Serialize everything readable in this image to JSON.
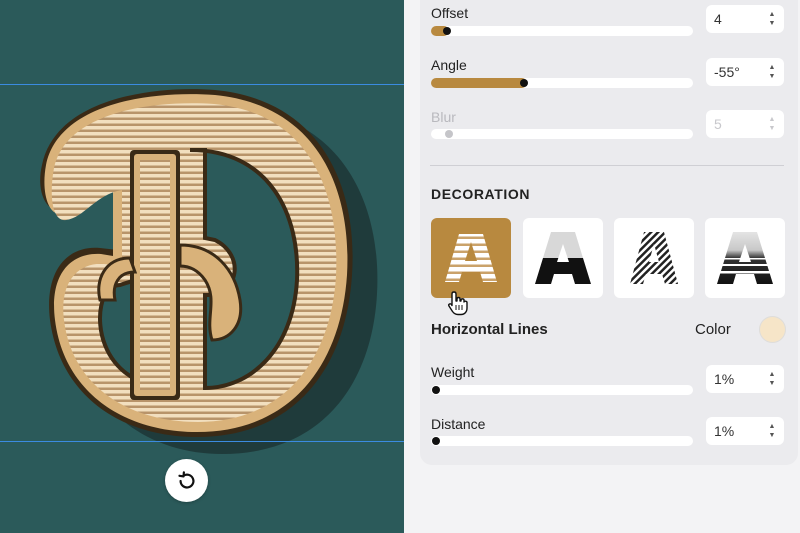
{
  "shadow": {
    "offset": {
      "label": "Offset",
      "value": "4",
      "level": 0.05
    },
    "angle": {
      "label": "Angle",
      "value": "-55°",
      "level": 0.35
    },
    "blur": {
      "label": "Blur",
      "value": "5",
      "level": 0.0
    }
  },
  "decoration": {
    "title": "DECORATION",
    "selected_style": "Horizontal Lines",
    "color_label": "Color",
    "color_value": "#f6e5c8",
    "styles": [
      "horizontal-lines",
      "gradient-top",
      "diagonal-lines",
      "gradient-lines"
    ],
    "weight": {
      "label": "Weight",
      "value": "1%",
      "level": 0.0
    },
    "distance": {
      "label": "Distance",
      "value": "1%",
      "level": 0.0
    }
  },
  "canvas": {
    "letter": "D",
    "background": "#2b5a5a",
    "letter_fill": "#e8caa0",
    "accent": "#b8893f"
  },
  "icons": {
    "reset": "rotate-ccw-icon",
    "cursor": "hand-pointer-icon"
  }
}
